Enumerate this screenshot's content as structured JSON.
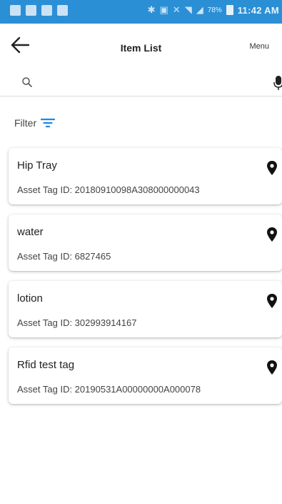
{
  "status_bar": {
    "time": "11:42 AM",
    "battery": "78%"
  },
  "app_bar": {
    "title": "Item List",
    "menu_label": "Menu"
  },
  "search": {
    "placeholder": ""
  },
  "filter": {
    "label": "Filter"
  },
  "items": [
    {
      "name": "Hip Tray",
      "tag_label": "Asset Tag ID: 20180910098A308000000043"
    },
    {
      "name": "water",
      "tag_label": "Asset Tag ID: 6827465"
    },
    {
      "name": "lotion",
      "tag_label": "Asset Tag ID: 302993914167"
    },
    {
      "name": "Rfid test tag",
      "tag_label": "Asset Tag ID: 20190531A00000000A000078"
    }
  ],
  "colors": {
    "status_bar": "#2b8fd6",
    "accent": "#1e88e5"
  }
}
